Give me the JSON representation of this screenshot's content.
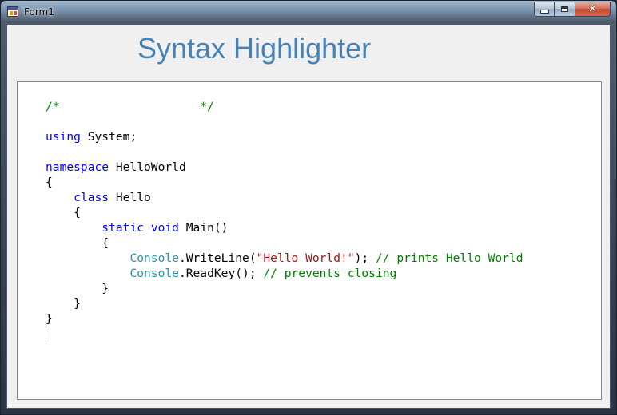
{
  "window": {
    "title": "Form1",
    "buttons": {
      "minimize": "minimize-icon",
      "maximize": "maximize-icon",
      "close": "close-icon"
    },
    "close_glyph": "✕"
  },
  "form": {
    "heading": "Syntax Highlighter",
    "heading_color": "#4682b4"
  },
  "editor": {
    "colors": {
      "comment": "#008000",
      "keyword": "#0000ff",
      "type": "#2b91af",
      "string": "#a31515",
      "plain": "#000000"
    },
    "lines": [
      [
        {
          "t": "comment",
          "v": "/*                    */"
        }
      ],
      [],
      [
        {
          "t": "keyword",
          "v": "using"
        },
        {
          "t": "plain",
          "v": " System;"
        }
      ],
      [],
      [
        {
          "t": "keyword",
          "v": "namespace"
        },
        {
          "t": "plain",
          "v": " HelloWorld"
        }
      ],
      [
        {
          "t": "plain",
          "v": "{"
        }
      ],
      [
        {
          "t": "plain",
          "v": "    "
        },
        {
          "t": "keyword",
          "v": "class"
        },
        {
          "t": "plain",
          "v": " Hello"
        }
      ],
      [
        {
          "t": "plain",
          "v": "    {"
        }
      ],
      [
        {
          "t": "plain",
          "v": "        "
        },
        {
          "t": "keyword",
          "v": "static"
        },
        {
          "t": "plain",
          "v": " "
        },
        {
          "t": "keyword",
          "v": "void"
        },
        {
          "t": "plain",
          "v": " Main()"
        }
      ],
      [
        {
          "t": "plain",
          "v": "        {"
        }
      ],
      [
        {
          "t": "plain",
          "v": "            "
        },
        {
          "t": "type",
          "v": "Console"
        },
        {
          "t": "plain",
          "v": ".WriteLine("
        },
        {
          "t": "string",
          "v": "\"Hello World!\""
        },
        {
          "t": "plain",
          "v": "); "
        },
        {
          "t": "comment",
          "v": "// prints Hello World"
        }
      ],
      [
        {
          "t": "plain",
          "v": "            "
        },
        {
          "t": "type",
          "v": "Console"
        },
        {
          "t": "plain",
          "v": ".ReadKey(); "
        },
        {
          "t": "comment",
          "v": "// prevents closing"
        }
      ],
      [
        {
          "t": "plain",
          "v": "        }"
        }
      ],
      [
        {
          "t": "plain",
          "v": "    }"
        }
      ],
      [
        {
          "t": "plain",
          "v": "}"
        }
      ],
      []
    ],
    "caret_line": 15
  }
}
